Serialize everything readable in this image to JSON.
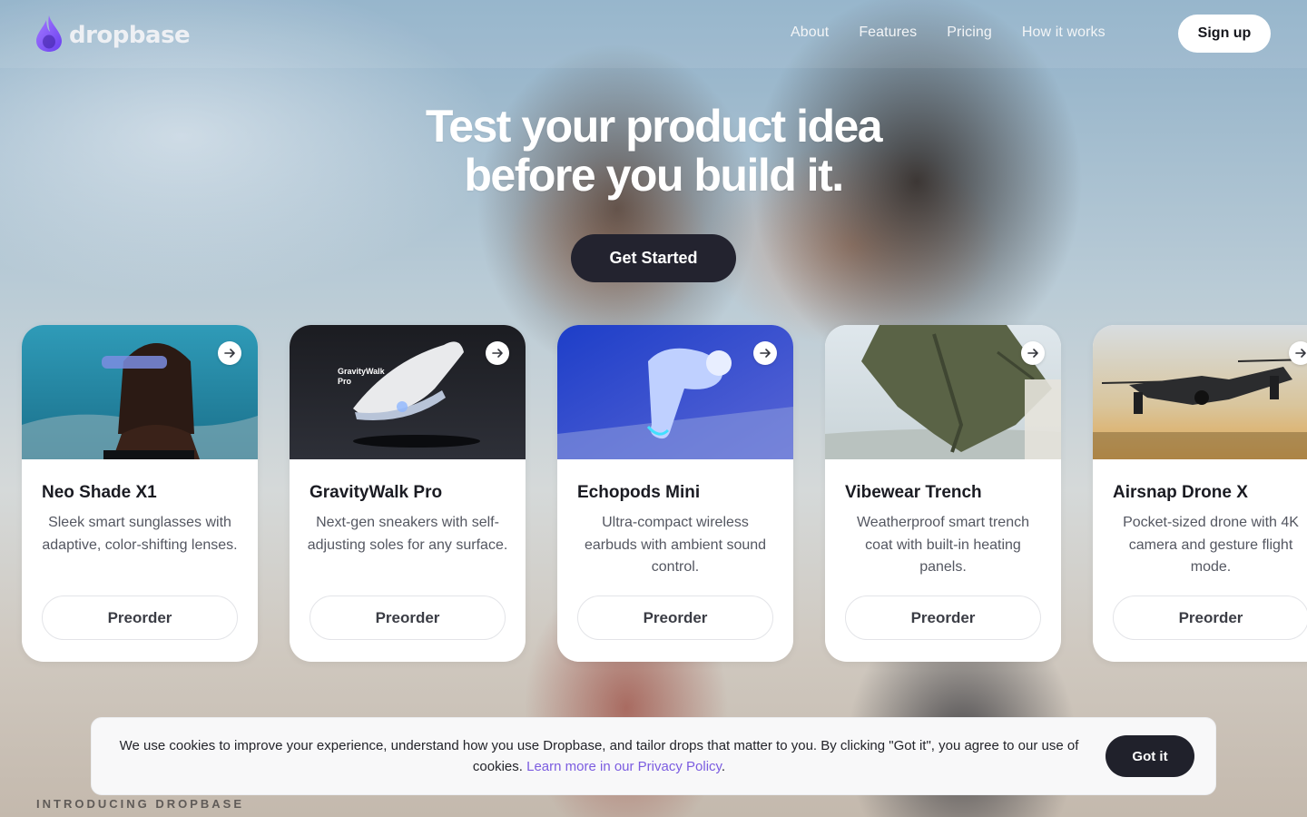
{
  "brand": {
    "name": "dropbase",
    "accent": "#7b5ce0"
  },
  "nav": {
    "links": [
      "About",
      "Features",
      "Pricing",
      "How it works"
    ],
    "signup_label": "Sign up"
  },
  "hero": {
    "title_line1": "Test your product idea",
    "title_line2": "before you build it.",
    "cta_label": "Get Started"
  },
  "cards": [
    {
      "title": "Neo Shade X1",
      "description": "Sleek smart sunglasses with adaptive, color-shifting lenses.",
      "button": "Preorder"
    },
    {
      "title": "GravityWalk Pro",
      "description": "Next-gen sneakers with self-adjusting soles for any surface.",
      "button": "Preorder",
      "image_text_line1": "GravityWalk",
      "image_text_line2": "Pro"
    },
    {
      "title": "Echopods Mini",
      "description": "Ultra-compact wireless earbuds with ambient sound control.",
      "button": "Preorder"
    },
    {
      "title": "Vibewear Trench",
      "description": "Weatherproof smart trench coat with built-in heating panels.",
      "button": "Preorder"
    },
    {
      "title": "Airsnap Drone X",
      "description": "Pocket-sized drone with 4K camera and gesture flight mode.",
      "button": "Preorder"
    }
  ],
  "cookie": {
    "text": "We use cookies to improve your experience, understand how you use Dropbase, and tailor drops that matter to you. By clicking \"Got it\", you agree to our use of cookies.",
    "link_text": "Learn more in our Privacy Policy",
    "trailing": ".",
    "button": "Got it"
  },
  "section_label": "INTRODUCING DROPBASE"
}
